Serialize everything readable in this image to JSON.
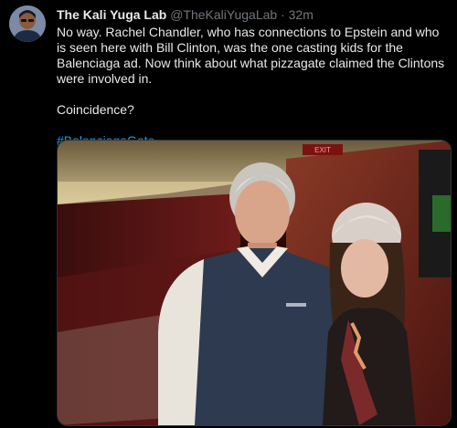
{
  "tweet": {
    "display_name": "The Kali Yuga Lab",
    "handle": "@TheKaliYugaLab",
    "separator": "·",
    "time": "32m",
    "text": "No way. Rachel Chandler, who has connections to Epstein and who is seen here with Bill Clinton, was the one casting kids for the Balenciaga ad. Now think about what pizzagate claimed the Clintons were involved in.",
    "text2": "Coincidence?",
    "hashtag": "#BalenciagaGate"
  },
  "media": {
    "sign_text": "EXIT"
  },
  "colors": {
    "background": "#000000",
    "text": "#e7e9ea",
    "secondary": "#71767b",
    "link": "#1d9bf0"
  }
}
